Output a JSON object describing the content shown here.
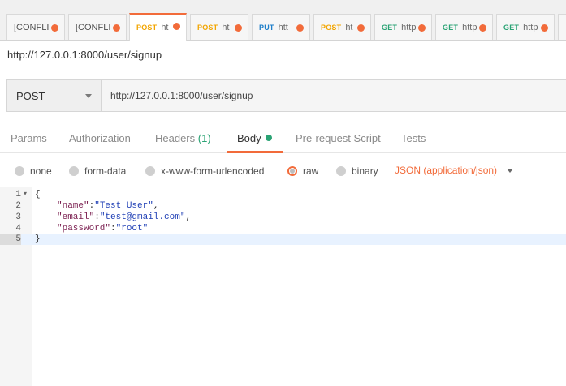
{
  "tabs": [
    {
      "method": "",
      "name": "[CONFLI",
      "method_color": "#505050",
      "active": false
    },
    {
      "method": "",
      "name": "[CONFLI",
      "method_color": "#505050",
      "active": false
    },
    {
      "method": "POST",
      "name": "ht",
      "method_color": "#f2a500",
      "active": true
    },
    {
      "method": "POST",
      "name": "ht",
      "method_color": "#f2a500",
      "active": false
    },
    {
      "method": "PUT",
      "name": "htt",
      "method_color": "#1f7fc9",
      "active": false
    },
    {
      "method": "POST",
      "name": "ht",
      "method_color": "#f2a500",
      "active": false
    },
    {
      "method": "GET",
      "name": "http",
      "method_color": "#2aa374",
      "active": false
    },
    {
      "method": "GET",
      "name": "http",
      "method_color": "#2aa374",
      "active": false
    },
    {
      "method": "GET",
      "name": "http",
      "method_color": "#2aa374",
      "active": false
    }
  ],
  "request": {
    "name": "http://127.0.0.1:8000/user/signup",
    "method": "POST",
    "url": "http://127.0.0.1:8000/user/signup"
  },
  "subtabs": {
    "params": "Params",
    "authorization": "Authorization",
    "headers": "Headers",
    "headers_count": "(1)",
    "body": "Body",
    "prerequest": "Pre-request Script",
    "tests": "Tests"
  },
  "body_types": {
    "none": "none",
    "form_data": "form-data",
    "urlencoded": "x-www-form-urlencoded",
    "raw": "raw",
    "binary": "binary",
    "selected": "raw",
    "format": "JSON (application/json)"
  },
  "editor": {
    "line_numbers": [
      "1",
      "2",
      "3",
      "4",
      "5"
    ],
    "fold_marker": "▾",
    "open_brace": "{",
    "close_brace": "}",
    "fields": [
      {
        "key": "\"name\"",
        "sep": ":",
        "value": "\"Test User\"",
        "trail": ","
      },
      {
        "key": "\"email\"",
        "sep": ":",
        "value": "\"test@gmail.com\"",
        "trail": ","
      },
      {
        "key": "\"password\"",
        "sep": ":",
        "value": "\"root\"",
        "trail": ""
      }
    ]
  },
  "colors": {
    "accent": "#f26b3a",
    "get": "#2aa374",
    "post": "#f2a500",
    "put": "#1f7fc9"
  }
}
